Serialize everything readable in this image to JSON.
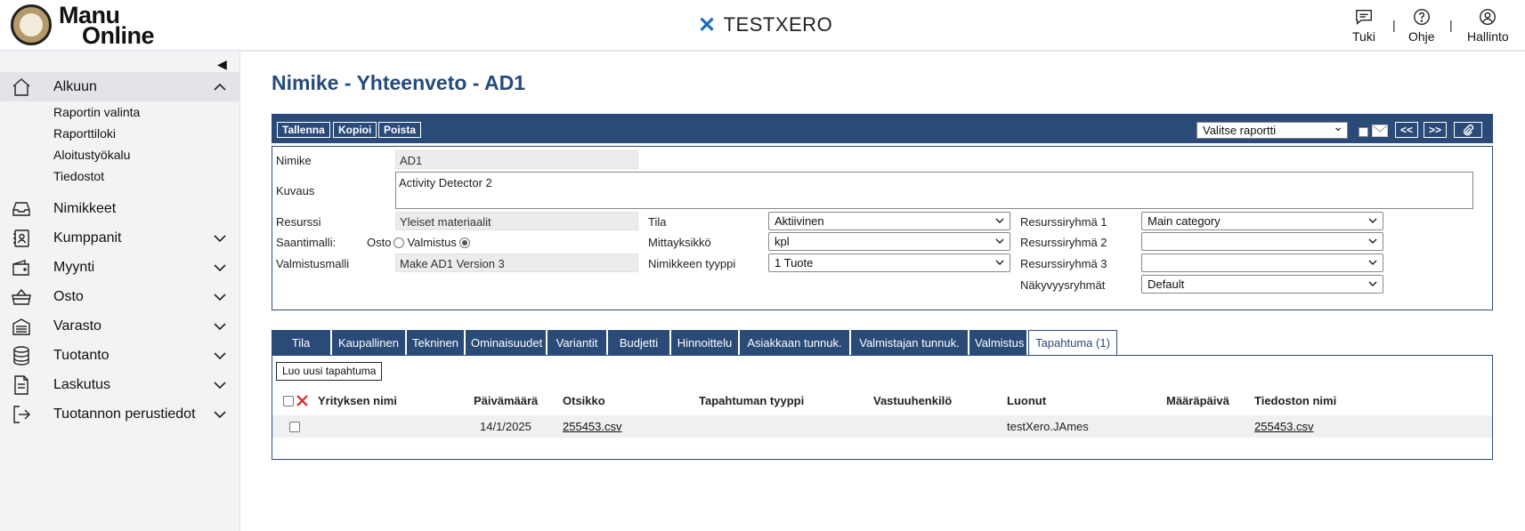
{
  "header": {
    "logo_line1": "Manu",
    "logo_line2": "Online",
    "brand": "TESTXERO",
    "links": [
      {
        "label": "Tuki",
        "icon": "chat-icon"
      },
      {
        "label": "Ohje",
        "icon": "help-icon"
      },
      {
        "label": "Hallinto",
        "icon": "user-icon"
      }
    ],
    "separator": "|"
  },
  "sidebar": {
    "collapse_icon": "chevron-left-icon",
    "items": [
      {
        "label": "Alkuun",
        "icon": "home-icon",
        "expanded": true
      },
      {
        "label": "Nimikkeet",
        "icon": "inbox-icon"
      },
      {
        "label": "Kumppanit",
        "icon": "contacts-icon"
      },
      {
        "label": "Myynti",
        "icon": "wallet-icon"
      },
      {
        "label": "Osto",
        "icon": "basket-icon"
      },
      {
        "label": "Varasto",
        "icon": "warehouse-icon"
      },
      {
        "label": "Tuotanto",
        "icon": "database-icon"
      },
      {
        "label": "Laskutus",
        "icon": "document-icon"
      },
      {
        "label": "Tuotannon perustiedot",
        "icon": "sign-in-icon"
      }
    ],
    "sub_items": [
      "Raportin valinta",
      "Raporttiloki",
      "Aloitustyökalu",
      "Tiedostot"
    ]
  },
  "page": {
    "title": "Nimike - Yhteenveto - AD1"
  },
  "toolbar": {
    "save": "Tallenna",
    "copy": "Kopioi",
    "delete": "Poista",
    "report_select": "Valitse raportti",
    "prev": "<<",
    "next": ">>",
    "attach_icon": "paperclip-icon",
    "mail_icon": "mail-icon"
  },
  "form": {
    "item_label": "Nimike",
    "item_value": "AD1",
    "desc_label": "Kuvaus",
    "desc_value": "Activity Detector 2",
    "resource_label": "Resurssi",
    "resource_value": "Yleiset materiaalit",
    "acq_label": "Saantimalli:",
    "acq_opt1": "Osto",
    "acq_opt2": "Valmistus",
    "acq_selected": "Valmistus",
    "mfg_label": "Valmistusmalli",
    "mfg_value": "Make AD1 Version 3",
    "state_label": "Tila",
    "state_value": "Aktiivinen",
    "unit_label": "Mittayksikkö",
    "unit_value": "kpl",
    "type_label": "Nimikkeen tyyppi",
    "type_value": "1 Tuote",
    "rg1_label": "Resurssiryhmä 1",
    "rg1_value": "Main category",
    "rg2_label": "Resurssiryhmä 2",
    "rg2_value": "",
    "rg3_label": "Resurssiryhmä 3",
    "rg3_value": "",
    "vis_label": "Näkyvyysryhmät",
    "vis_value": "Default"
  },
  "tabs": [
    "Tila",
    "Kaupallinen",
    "Tekninen",
    "Ominaisuudet",
    "Variantit",
    "Budjetti",
    "Hinnoittelu",
    "Asiakkaan tunnuk.",
    "Valmistajan tunnuk.",
    "Valmistus",
    "Tapahtuma (1)"
  ],
  "active_tab": "Tapahtuma (1)",
  "events": {
    "new_button": "Luo uusi tapahtuma",
    "columns": [
      "Yrityksen nimi",
      "Päivämäärä",
      "Otsikko",
      "Tapahtuman tyyppi",
      "Vastuuhenkilö",
      "Luonut",
      "Määräpäivä",
      "Tiedoston nimi"
    ],
    "rows": [
      {
        "company": "",
        "date": "14/1/2025",
        "title": "255453.csv",
        "type": "",
        "responsible": "",
        "created_by": "testXero.JAmes",
        "due": "",
        "file": "255453.csv"
      }
    ]
  },
  "colors": {
    "primary": "#2a4a78",
    "title": "#254a7c",
    "brand_x": "#1d6fb7",
    "delete_x": "#d33333"
  }
}
